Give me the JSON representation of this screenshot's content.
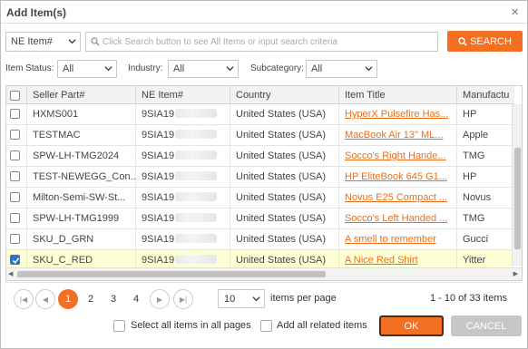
{
  "dialog": {
    "title": "Add Item(s)",
    "close_icon": "close-icon"
  },
  "search": {
    "type_value": "NE Item#",
    "placeholder": "Click Search button to see All Items or input search criteria",
    "button_label": "SEARCH"
  },
  "filters": {
    "status_label": "Item Status:",
    "status_value": "All",
    "industry_label": "Industry:",
    "industry_value": "All",
    "subcategory_label": "Subcategory:",
    "subcategory_value": "All"
  },
  "table": {
    "columns": [
      "Seller Part#",
      "NE Item#",
      "Country",
      "Item Title",
      "Manufactu"
    ],
    "rows": [
      {
        "part": "HXMS001",
        "item": "9SIA19",
        "country": "United States (USA)",
        "title": "HyperX Pulsefire Has...",
        "mfr": "HP",
        "checked": false
      },
      {
        "part": "TESTMAC",
        "item": "9SIA19",
        "country": "United States (USA)",
        "title": "MacBook Air 13\" ML...",
        "mfr": "Apple",
        "checked": false
      },
      {
        "part": "SPW-LH-TMG2024",
        "item": "9SIA19",
        "country": "United States (USA)",
        "title": "Socco's Right Hande...",
        "mfr": "TMG",
        "checked": false
      },
      {
        "part": "TEST-NEWEGG_Con...",
        "item": "9SIA19",
        "country": "United States (USA)",
        "title": "HP EliteBook 645 G1...",
        "mfr": "HP",
        "checked": false
      },
      {
        "part": "Milton-Semi-SW-St...",
        "item": "9SIA19",
        "country": "United States (USA)",
        "title": "Novus E25 Compact ...",
        "mfr": "Novus",
        "checked": false
      },
      {
        "part": "SPW-LH-TMG1999",
        "item": "9SIA19",
        "country": "United States (USA)",
        "title": "Socco's Left Handed ...",
        "mfr": "TMG",
        "checked": false
      },
      {
        "part": "SKU_D_GRN",
        "item": "9SIA19",
        "country": "United States (USA)",
        "title": "A smell to remember",
        "mfr": "Gucci",
        "checked": false
      },
      {
        "part": "SKU_C_RED",
        "item": "9SIA19",
        "country": "United States (USA)",
        "title": "A Nice Red Shirt",
        "mfr": "Yitter",
        "checked": true
      }
    ]
  },
  "pager": {
    "pages": [
      "1",
      "2",
      "3",
      "4"
    ],
    "page_size": "10",
    "items_per_page_label": "items per page",
    "summary": "1 - 10 of 33 items"
  },
  "footer": {
    "select_all_label": "Select all items in all pages",
    "add_related_label": "Add all related items",
    "ok_label": "OK",
    "cancel_label": "CANCEL"
  },
  "colors": {
    "accent": "#f36f21",
    "selected_row": "#ffffd6",
    "link": "#e8701d"
  }
}
